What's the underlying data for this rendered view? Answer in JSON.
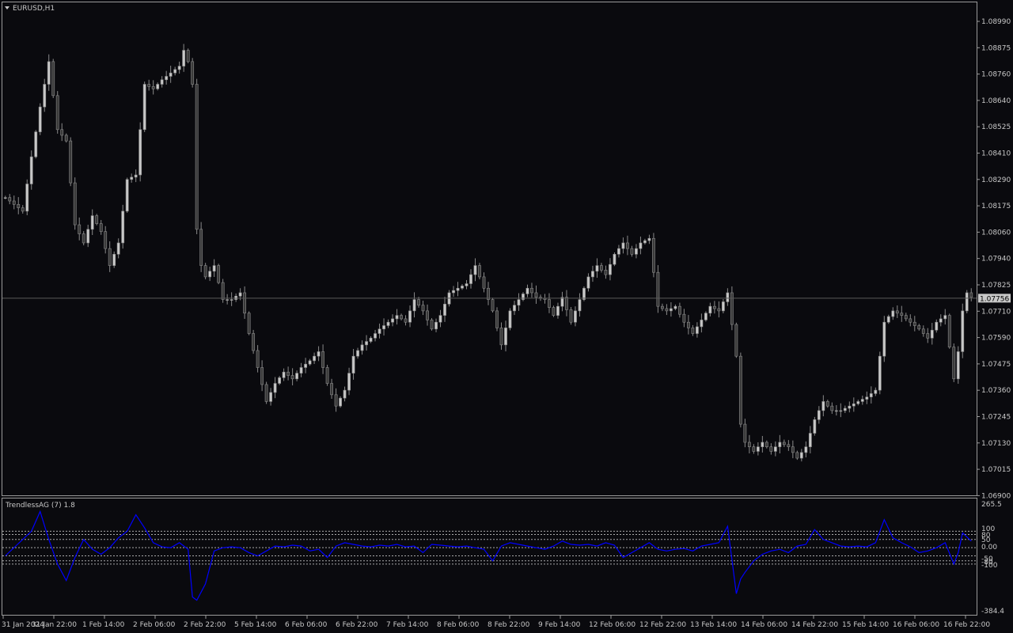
{
  "symbol_title": "EURUSD,H1",
  "colors": {
    "background": "#0a0a0e",
    "frame": "#9a9a9a",
    "candle_bull_body": "#c8c8c8",
    "candle_bear_body": "#3a3a3a",
    "candle_wick": "#8a8a8a",
    "price_line": "#5a5a5a",
    "price_tag_bg": "#c8c8c8",
    "price_tag_text": "#000000",
    "indicator_line": "#0000ff",
    "level_lines": "#c8c8c8"
  },
  "current_price": "1.07756",
  "chart_data": [
    {
      "type": "candlestick",
      "title": "EURUSD,H1",
      "y_ticks": [
        "1.08990",
        "1.08875",
        "1.08760",
        "1.08640",
        "1.08525",
        "1.08410",
        "1.08290",
        "1.08175",
        "1.08060",
        "1.07940",
        "1.07825",
        "1.07710",
        "1.07590",
        "1.07475",
        "1.07360",
        "1.07245",
        "1.07130",
        "1.07015",
        "1.06900"
      ],
      "x_ticks": [
        "31 Jan 2024",
        "31 Jan 22:00",
        "1 Feb 14:00",
        "2 Feb 06:00",
        "2 Feb 22:00",
        "5 Feb 14:00",
        "6 Feb 06:00",
        "6 Feb 22:00",
        "7 Feb 14:00",
        "8 Feb 06:00",
        "8 Feb 22:00",
        "9 Feb 14:00",
        "12 Feb 06:00",
        "12 Feb 22:00",
        "13 Feb 14:00",
        "14 Feb 06:00",
        "14 Feb 22:00",
        "15 Feb 14:00",
        "16 Feb 06:00",
        "16 Feb 22:00"
      ],
      "ylim": [
        1.069,
        1.0903
      ],
      "close_path": [
        [
          0,
          1.082
        ],
        [
          4,
          1.0814
        ],
        [
          6,
          1.0838
        ],
        [
          8,
          1.086
        ],
        [
          10,
          1.088
        ],
        [
          12,
          1.085
        ],
        [
          14,
          1.0845
        ],
        [
          16,
          1.0808
        ],
        [
          18,
          1.08
        ],
        [
          20,
          1.0812
        ],
        [
          22,
          1.0805
        ],
        [
          24,
          1.079
        ],
        [
          26,
          1.08
        ],
        [
          28,
          1.0828
        ],
        [
          30,
          1.083
        ],
        [
          32,
          1.087
        ],
        [
          34,
          1.0868
        ],
        [
          36,
          1.0872
        ],
        [
          38,
          1.0875
        ],
        [
          40,
          1.0878
        ],
        [
          41,
          1.0885
        ],
        [
          42,
          1.088
        ],
        [
          43,
          1.087
        ],
        [
          44,
          1.0806
        ],
        [
          45,
          1.079
        ],
        [
          46,
          1.0785
        ],
        [
          48,
          1.079
        ],
        [
          50,
          1.0775
        ],
        [
          52,
          1.0775
        ],
        [
          54,
          1.0778
        ],
        [
          56,
          1.076
        ],
        [
          58,
          1.0745
        ],
        [
          60,
          1.073
        ],
        [
          62,
          1.0738
        ],
        [
          64,
          1.0743
        ],
        [
          66,
          1.074
        ],
        [
          68,
          1.0745
        ],
        [
          70,
          1.0748
        ],
        [
          72,
          1.0752
        ],
        [
          74,
          1.0738
        ],
        [
          76,
          1.0728
        ],
        [
          78,
          1.0735
        ],
        [
          80,
          1.075
        ],
        [
          82,
          1.0755
        ],
        [
          84,
          1.0758
        ],
        [
          86,
          1.0762
        ],
        [
          88,
          1.0765
        ],
        [
          90,
          1.0768
        ],
        [
          92,
          1.0765
        ],
        [
          94,
          1.0775
        ],
        [
          96,
          1.077
        ],
        [
          98,
          1.0762
        ],
        [
          100,
          1.0768
        ],
        [
          102,
          1.0778
        ],
        [
          104,
          1.078
        ],
        [
          106,
          1.0782
        ],
        [
          108,
          1.079
        ],
        [
          110,
          1.078
        ],
        [
          112,
          1.077
        ],
        [
          114,
          1.0755
        ],
        [
          116,
          1.077
        ],
        [
          118,
          1.0775
        ],
        [
          120,
          1.078
        ],
        [
          122,
          1.0776
        ],
        [
          124,
          1.0775
        ],
        [
          126,
          1.0768
        ],
        [
          128,
          1.0776
        ],
        [
          130,
          1.0765
        ],
        [
          132,
          1.0775
        ],
        [
          134,
          1.0785
        ],
        [
          136,
          1.079
        ],
        [
          138,
          1.0786
        ],
        [
          140,
          1.0795
        ],
        [
          142,
          1.08
        ],
        [
          144,
          1.0795
        ],
        [
          146,
          1.08
        ],
        [
          148,
          1.0802
        ],
        [
          150,
          1.0772
        ],
        [
          152,
          1.077
        ],
        [
          154,
          1.0772
        ],
        [
          156,
          1.0765
        ],
        [
          158,
          1.076
        ],
        [
          160,
          1.0766
        ],
        [
          162,
          1.0772
        ],
        [
          164,
          1.077
        ],
        [
          166,
          1.0778
        ],
        [
          168,
          1.075
        ],
        [
          169,
          1.072
        ],
        [
          170,
          1.0712
        ],
        [
          172,
          1.0708
        ],
        [
          174,
          1.0712
        ],
        [
          176,
          1.0708
        ],
        [
          178,
          1.0712
        ],
        [
          180,
          1.071
        ],
        [
          182,
          1.0705
        ],
        [
          184,
          1.071
        ],
        [
          186,
          1.0722
        ],
        [
          188,
          1.073
        ],
        [
          190,
          1.0726
        ],
        [
          192,
          1.0726
        ],
        [
          194,
          1.0728
        ],
        [
          196,
          1.073
        ],
        [
          198,
          1.0732
        ],
        [
          200,
          1.0735
        ],
        [
          202,
          1.0765
        ],
        [
          204,
          1.077
        ],
        [
          206,
          1.0768
        ],
        [
          208,
          1.0765
        ],
        [
          210,
          1.0762
        ],
        [
          212,
          1.0758
        ],
        [
          214,
          1.0765
        ],
        [
          216,
          1.0768
        ],
        [
          218,
          1.074
        ],
        [
          219,
          1.0752
        ],
        [
          220,
          1.077
        ],
        [
          221,
          1.0778
        ],
        [
          222,
          1.0776
        ]
      ]
    },
    {
      "type": "line",
      "title": "TrendlessAG (7) 1.8",
      "y_ticks": [
        "265.5",
        "100",
        "80",
        "50",
        "0.00",
        "-50",
        "-80",
        "-100",
        "-384.4"
      ],
      "levels": [
        100,
        80,
        50,
        0,
        -50,
        -80,
        -100
      ],
      "ylim": [
        -384.4,
        265.5
      ],
      "series": [
        {
          "name": "TrendlessAG (7) 1.8",
          "values": [
            [
              0,
              -50
            ],
            [
              6,
              100
            ],
            [
              8,
              220
            ],
            [
              10,
              50
            ],
            [
              12,
              -100
            ],
            [
              14,
              -200
            ],
            [
              16,
              -60
            ],
            [
              18,
              50
            ],
            [
              20,
              -10
            ],
            [
              22,
              -40
            ],
            [
              24,
              0
            ],
            [
              26,
              60
            ],
            [
              28,
              100
            ],
            [
              30,
              200
            ],
            [
              32,
              120
            ],
            [
              34,
              30
            ],
            [
              36,
              5
            ],
            [
              38,
              0
            ],
            [
              40,
              30
            ],
            [
              42,
              -10
            ],
            [
              43,
              -300
            ],
            [
              44,
              -320
            ],
            [
              46,
              -220
            ],
            [
              48,
              -20
            ],
            [
              50,
              0
            ],
            [
              52,
              5
            ],
            [
              54,
              0
            ],
            [
              56,
              -30
            ],
            [
              58,
              -50
            ],
            [
              60,
              -20
            ],
            [
              62,
              10
            ],
            [
              64,
              5
            ],
            [
              66,
              15
            ],
            [
              68,
              10
            ],
            [
              70,
              -20
            ],
            [
              72,
              -10
            ],
            [
              74,
              -60
            ],
            [
              76,
              10
            ],
            [
              78,
              30
            ],
            [
              80,
              20
            ],
            [
              82,
              10
            ],
            [
              84,
              5
            ],
            [
              86,
              15
            ],
            [
              88,
              10
            ],
            [
              90,
              20
            ],
            [
              92,
              5
            ],
            [
              94,
              10
            ],
            [
              96,
              -30
            ],
            [
              98,
              20
            ],
            [
              100,
              15
            ],
            [
              102,
              10
            ],
            [
              104,
              5
            ],
            [
              106,
              10
            ],
            [
              108,
              0
            ],
            [
              110,
              -10
            ],
            [
              112,
              -80
            ],
            [
              114,
              10
            ],
            [
              116,
              30
            ],
            [
              118,
              20
            ],
            [
              120,
              10
            ],
            [
              122,
              0
            ],
            [
              124,
              -10
            ],
            [
              126,
              10
            ],
            [
              128,
              40
            ],
            [
              130,
              20
            ],
            [
              132,
              15
            ],
            [
              134,
              20
            ],
            [
              136,
              10
            ],
            [
              138,
              30
            ],
            [
              140,
              15
            ],
            [
              142,
              -60
            ],
            [
              144,
              -30
            ],
            [
              146,
              0
            ],
            [
              148,
              30
            ],
            [
              150,
              -10
            ],
            [
              152,
              -20
            ],
            [
              154,
              -10
            ],
            [
              156,
              -5
            ],
            [
              158,
              -20
            ],
            [
              160,
              10
            ],
            [
              162,
              20
            ],
            [
              164,
              30
            ],
            [
              166,
              130
            ],
            [
              168,
              -280
            ],
            [
              169,
              -190
            ],
            [
              170,
              -150
            ],
            [
              172,
              -80
            ],
            [
              174,
              -40
            ],
            [
              176,
              -20
            ],
            [
              178,
              -10
            ],
            [
              180,
              -30
            ],
            [
              182,
              10
            ],
            [
              184,
              20
            ],
            [
              186,
              110
            ],
            [
              188,
              50
            ],
            [
              190,
              30
            ],
            [
              192,
              10
            ],
            [
              194,
              5
            ],
            [
              196,
              10
            ],
            [
              198,
              5
            ],
            [
              200,
              30
            ],
            [
              202,
              170
            ],
            [
              204,
              60
            ],
            [
              206,
              30
            ],
            [
              208,
              5
            ],
            [
              210,
              -30
            ],
            [
              212,
              -20
            ],
            [
              214,
              0
            ],
            [
              216,
              30
            ],
            [
              218,
              -100
            ],
            [
              219,
              -30
            ],
            [
              220,
              90
            ],
            [
              222,
              40
            ]
          ]
        }
      ]
    }
  ]
}
